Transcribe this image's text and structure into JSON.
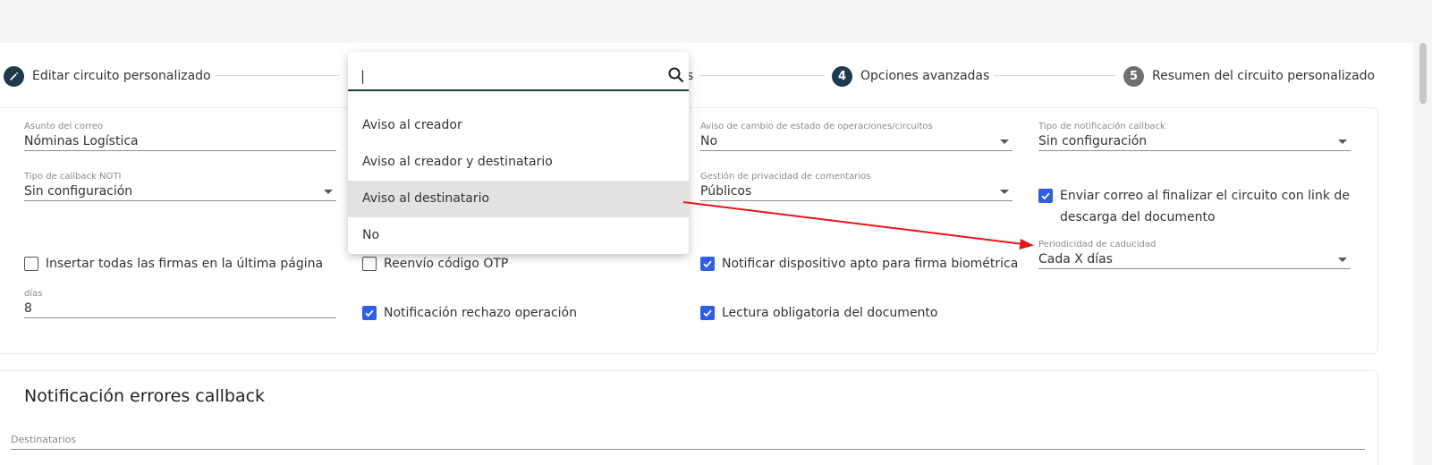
{
  "stepper": {
    "steps": [
      {
        "number": "",
        "label": "Editar circuito personalizado"
      },
      {
        "number": "",
        "label": "s"
      },
      {
        "number": "4",
        "label": "Opciones avanzadas"
      },
      {
        "number": "5",
        "label": "Resumen del circuito personalizado"
      }
    ]
  },
  "fields": {
    "asunto": {
      "label": "Asunto del correo",
      "value": "Nóminas Logística"
    },
    "aviso_cambio": {
      "label": "Aviso de cambio de estado de operaciones/circuitos",
      "value": "No"
    },
    "tipo_notificacion": {
      "label": "Tipo de notificación callback",
      "value": "Sin configuración"
    },
    "tipo_callback": {
      "label": "Tipo de callback NOTI",
      "value": "Sin configuración"
    },
    "privacidad": {
      "label": "Gestión de privacidad de comentarios",
      "value": "Públicos"
    },
    "periodicidad": {
      "label": "Periodicidad de caducidad",
      "value": "Cada X días"
    },
    "dias": {
      "label": "días",
      "value": "8"
    }
  },
  "checkboxes": {
    "enviar_correo": {
      "label": "Enviar correo al finalizar el circuito con link de descarga del documento",
      "checked": true
    },
    "insertar_firmas": {
      "label": "Insertar todas las firmas en la última página",
      "checked": false
    },
    "reenvio_otp": {
      "label": "Reenvío código OTP",
      "checked": false
    },
    "notificar_dispositivo": {
      "label": "Notificar dispositivo apto para firma biométrica",
      "checked": true
    },
    "notificacion_rechazo": {
      "label": "Notificación rechazo operación",
      "checked": true
    },
    "lectura_obligatoria": {
      "label": "Lectura obligatoria del documento",
      "checked": true
    }
  },
  "errors_section": {
    "title": "Notificación errores callback",
    "recipients_label": "Destinatarios"
  },
  "dropdown": {
    "search_value": "|",
    "options": [
      "Aviso al creador",
      "Aviso al creador y destinatario",
      "Aviso al destinatario",
      "No"
    ],
    "highlighted": "Aviso al destinatario"
  },
  "colors": {
    "primary": "#1f3a4d",
    "checkbox": "#2f5ee6",
    "annotation_arrow": "#e8141b",
    "highlight": "#e2e2e2"
  }
}
